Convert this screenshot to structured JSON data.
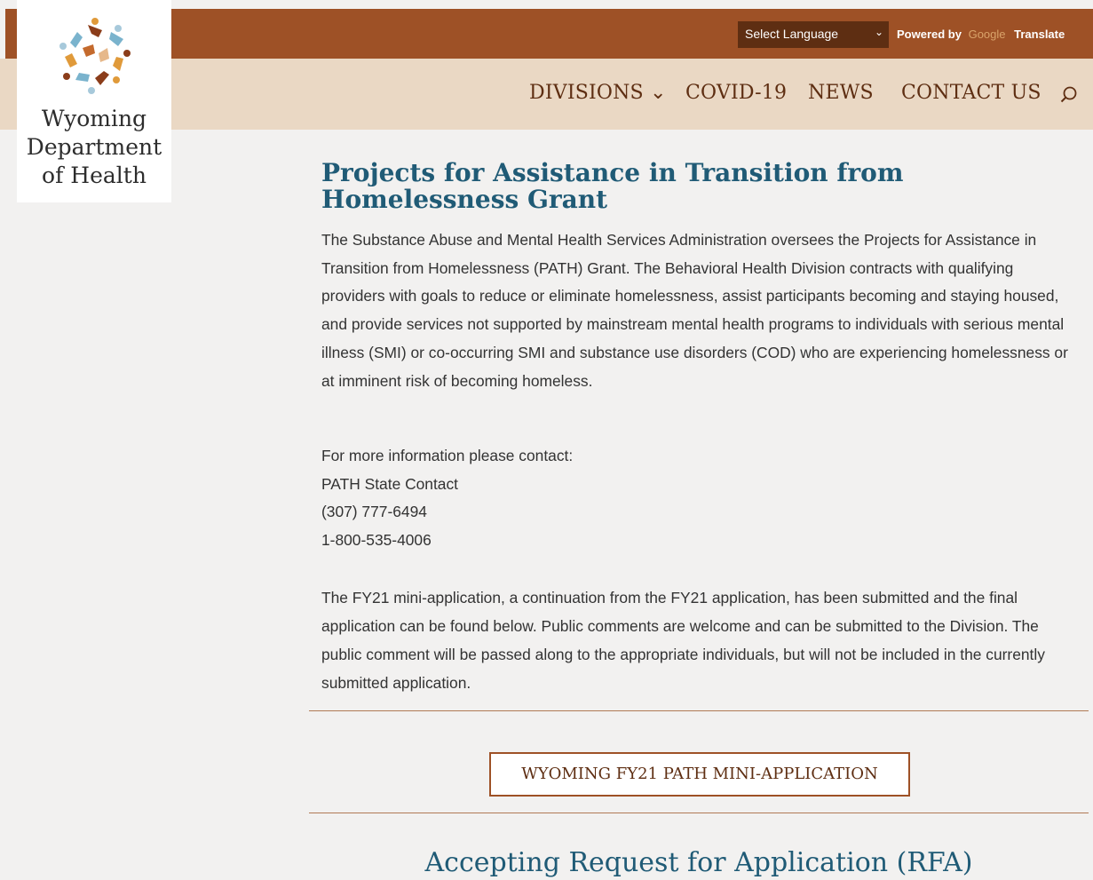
{
  "header": {
    "language_select": "Select Language",
    "powered_by": "Powered by",
    "google": "Google",
    "translate": "Translate",
    "brand_color": "#9e5126",
    "nav_bg_color": "#ead8c4"
  },
  "nav": {
    "items": [
      {
        "label": "DIVISIONS ⌄"
      },
      {
        "label": "COVID-19"
      },
      {
        "label": "NEWS"
      },
      {
        "label": "CONTACT US"
      }
    ],
    "search_icon": "search-icon"
  },
  "logo": {
    "lines": [
      "Wyoming",
      "Department",
      "of Health"
    ]
  },
  "main": {
    "title": "Projects for Assistance in Transition from Homelessness Grant",
    "intro": "The Substance Abuse and Mental Health Services Administration oversees the Projects for Assistance in Transition from Homelessness (PATH) Grant. The Behavioral Health Division contracts with qualifying providers with goals to reduce or eliminate homelessness, assist participants becoming and staying housed, and provide services not supported by mainstream mental health programs to individuals with serious mental illness (SMI) or co-occurring SMI and substance use disorders (COD) who are experiencing homelessness or at imminent risk of becoming homeless.",
    "contact": {
      "lead": "For more information please contact:",
      "name": "PATH State Contact",
      "phone1": "(307) 777-6494",
      "phone2": "1-800-535-4006"
    },
    "application_text": "The FY21 mini-application, a continuation from the FY21 application, has been submitted and the final application can be found below. Public comments are welcome and can be submitted to the Division. The public comment will be passed along to the appropriate individuals, but will not be included in the currently submitted application.",
    "button_label": "WYOMING FY21 PATH MINI-APPLICATION",
    "rfa_heading": "Accepting Request for Application (RFA)",
    "heading_color": "#205b76"
  }
}
